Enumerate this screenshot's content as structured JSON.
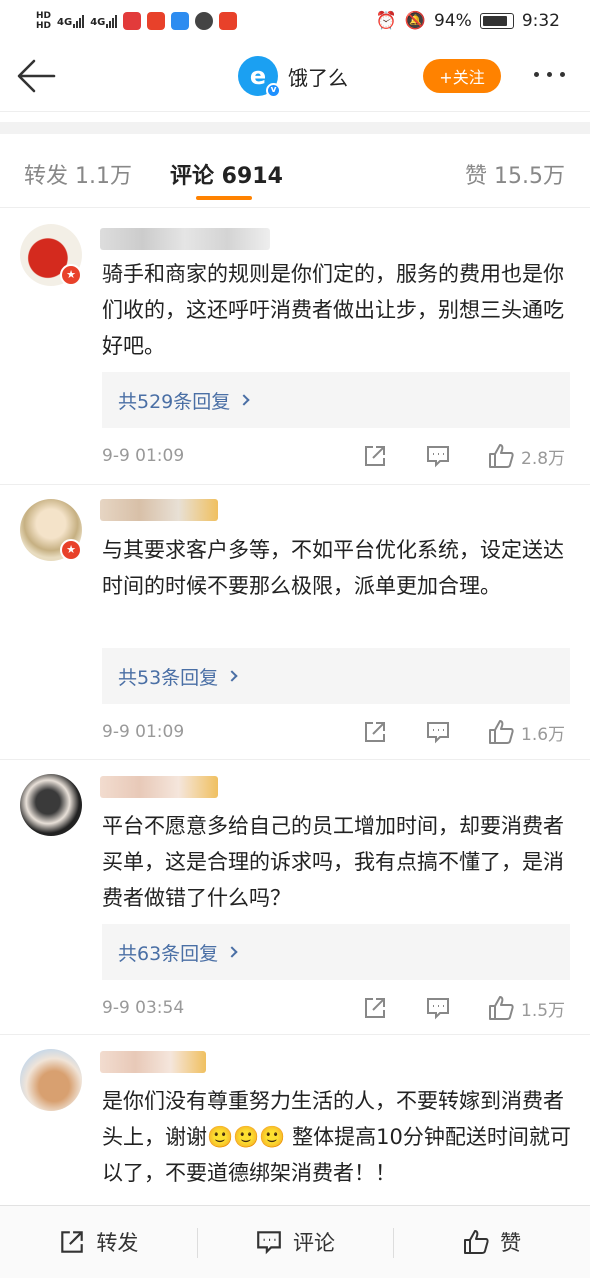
{
  "status_bar": {
    "battery": "94%",
    "time": "9:32",
    "net_1": "4G",
    "net_2": "4G"
  },
  "nav": {
    "title": "饿了么",
    "follow_label": "+关注"
  },
  "tabs": {
    "repost": "转发 1.1万",
    "comments": "评论 6914",
    "likes": "赞 15.5万"
  },
  "comments": [
    {
      "text": "骑手和商家的规则是你们定的，服务的费用也是你们收的，这还呼吁消费者做出让步，别想三头通吃好吧。",
      "replies": "共529条回复",
      "time": "9-9 01:09",
      "likes": "2.8万"
    },
    {
      "text": "与其要求客户多等，不如平台优化系统，设定送达时间的时候不要那么极限，派单更加合理。",
      "replies": "共53条回复",
      "time": "9-9 01:09",
      "likes": "1.6万"
    },
    {
      "text": "平台不愿意多给自己的员工增加时间，却要消费者买单，这是合理的诉求吗，我有点搞不懂了，是消费者做错了什么吗？",
      "replies": "共63条回复",
      "time": "9-9 03:54",
      "likes": "1.5万"
    },
    {
      "text": "是你们没有尊重努力生活的人，不要转嫁到消费者头上，谢谢🙂🙂🙂 整体提高10分钟配送时间就可以了，不要道德绑架消费者！！"
    }
  ],
  "bottom_bar": {
    "repost": "转发",
    "comment": "评论",
    "like": "赞"
  },
  "colors": {
    "accent": "#ff8200",
    "link": "#4a6fa5",
    "badge": "#e8412a",
    "brand": "#1ba0f2"
  }
}
